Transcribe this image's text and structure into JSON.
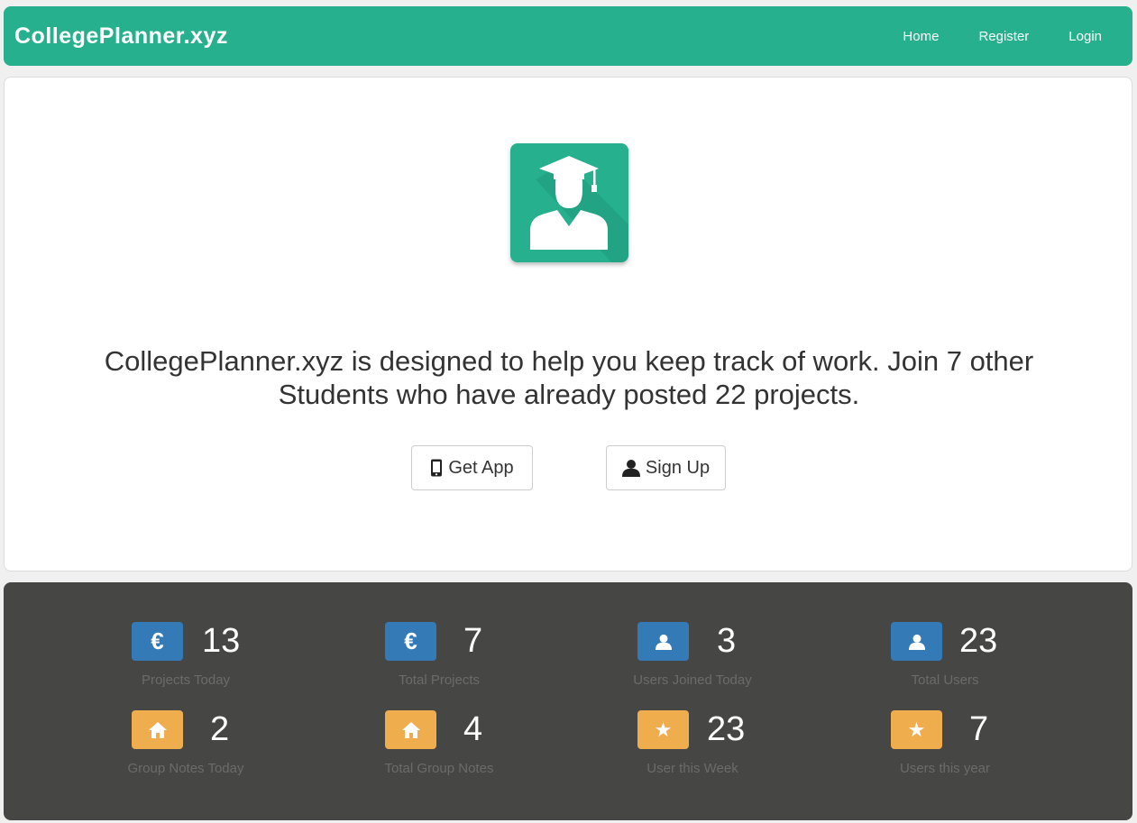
{
  "navbar": {
    "brand": "CollegePlanner.xyz",
    "links": [
      "Home",
      "Register",
      "Login"
    ],
    "color": "#26b08e"
  },
  "hero": {
    "logo_icon": "graduate-student-icon",
    "tagline": "CollegePlanner.xyz is designed to help you keep track of work. Join 7 other Students who have already posted 22 projects.",
    "buttons": {
      "get_app": {
        "label": "Get App",
        "icon": "mobile-phone-icon"
      },
      "sign_up": {
        "label": "Sign Up",
        "icon": "user-icon"
      }
    }
  },
  "stats": [
    {
      "icon": "euro-icon",
      "color": "#337ab7",
      "value": "13",
      "label": "Projects Today"
    },
    {
      "icon": "euro-icon",
      "color": "#337ab7",
      "value": "7",
      "label": "Total Projects"
    },
    {
      "icon": "user-icon",
      "color": "#337ab7",
      "value": "3",
      "label": "Users Joined Today"
    },
    {
      "icon": "user-icon",
      "color": "#337ab7",
      "value": "23",
      "label": "Total Users"
    },
    {
      "icon": "home-icon",
      "color": "#f0ad4e",
      "value": "2",
      "label": "Group Notes Today"
    },
    {
      "icon": "home-icon",
      "color": "#f0ad4e",
      "value": "4",
      "label": "Total Group Notes"
    },
    {
      "icon": "star-icon",
      "color": "#f0ad4e",
      "value": "23",
      "label": "User this Week"
    },
    {
      "icon": "star-icon",
      "color": "#f0ad4e",
      "value": "7",
      "label": "Users this year"
    }
  ]
}
